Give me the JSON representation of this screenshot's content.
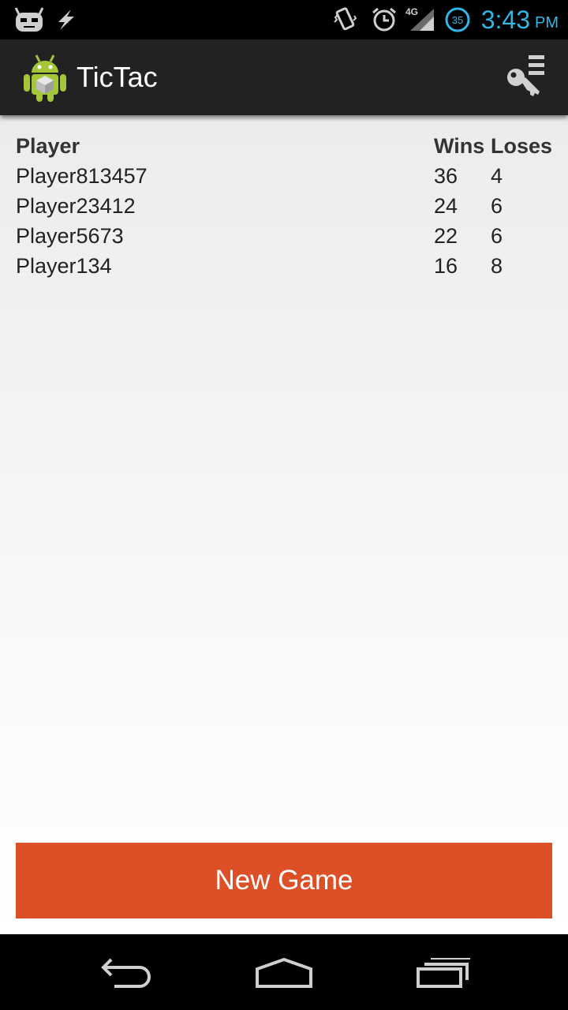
{
  "status_bar": {
    "time": "3:43",
    "ampm": "PM",
    "network": "4G",
    "battery_level": "35",
    "accent_color": "#33b5e5",
    "icons": [
      "cyanogen-icon",
      "flash-icon",
      "vibrate-icon",
      "alarm-icon",
      "signal-icon",
      "battery-icon"
    ]
  },
  "action_bar": {
    "title": "TicTac",
    "app_icon": "android-robot-icon",
    "overflow_icon": "key-menu-icon"
  },
  "scores": {
    "headers": {
      "player": "Player",
      "wins": "Wins",
      "loses": "Loses"
    },
    "rows": [
      {
        "player": "Player813457",
        "wins": "36",
        "loses": "4"
      },
      {
        "player": "Player23412",
        "wins": "24",
        "loses": "6"
      },
      {
        "player": "Player5673",
        "wins": "22",
        "loses": "6"
      },
      {
        "player": "Player134",
        "wins": "16",
        "loses": "8"
      }
    ]
  },
  "new_game": {
    "label": "New Game",
    "color": "#dd5027"
  },
  "nav_bar": {
    "icons": [
      "back-icon",
      "home-icon",
      "recent-apps-icon"
    ]
  }
}
